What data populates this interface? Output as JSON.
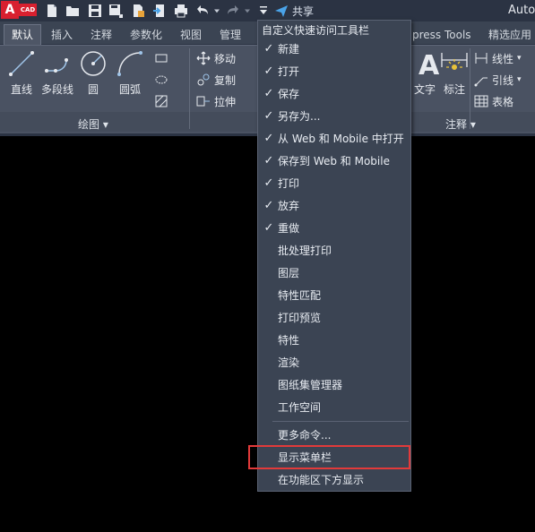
{
  "app": {
    "logo_a": "A",
    "logo_cad": "CAD",
    "title": "Autoc"
  },
  "qat": {
    "share_label": "共享",
    "icons": [
      "new-file-icon",
      "open-folder-icon",
      "save-icon",
      "save-as-icon",
      "publish-icon",
      "import-icon",
      "print-icon",
      "undo-icon",
      "redo-icon",
      "customize-dropdown-icon"
    ]
  },
  "tabs": [
    {
      "label": "默认",
      "active": true
    },
    {
      "label": "插入"
    },
    {
      "label": "注释"
    },
    {
      "label": "参数化"
    },
    {
      "label": "视图"
    },
    {
      "label": "管理"
    },
    {
      "label": "press Tools"
    },
    {
      "label": "精选应用"
    }
  ],
  "ribbon": {
    "draw_tools": [
      "直线",
      "多段线",
      "圆",
      "圆弧"
    ],
    "modify_tools": [
      "移动",
      "复制",
      "拉伸"
    ],
    "annotation_tools": [
      "文字",
      "标注"
    ],
    "annotation_small": [
      "线性",
      "引线",
      "表格"
    ],
    "draw_panel_title": "绘图 ▾",
    "annotation_panel_title": "注释 ▾"
  },
  "menu": {
    "header": "自定义快速访问工具栏",
    "items": [
      {
        "label": "新建",
        "checked": true
      },
      {
        "label": "打开",
        "checked": true
      },
      {
        "label": "保存",
        "checked": true
      },
      {
        "label": "另存为...",
        "checked": true
      },
      {
        "label": "从 Web 和 Mobile 中打开",
        "checked": true
      },
      {
        "label": "保存到 Web 和 Mobile",
        "checked": true
      },
      {
        "label": "打印",
        "checked": true
      },
      {
        "label": "放弃",
        "checked": true
      },
      {
        "label": "重做",
        "checked": true
      },
      {
        "label": "批处理打印",
        "checked": false
      },
      {
        "label": "图层",
        "checked": false
      },
      {
        "label": "特性匹配",
        "checked": false
      },
      {
        "label": "打印预览",
        "checked": false
      },
      {
        "label": "特性",
        "checked": false
      },
      {
        "label": "渲染",
        "checked": false
      },
      {
        "label": "图纸集管理器",
        "checked": false
      },
      {
        "label": "工作空间",
        "checked": false
      }
    ],
    "more_commands": "更多命令...",
    "show_menubar": "显示菜单栏",
    "show_below_ribbon": "在功能区下方显示",
    "check_mark": "✓"
  },
  "colors": {
    "highlight_box": "#e23a3a",
    "logo_red": "#d8202f",
    "menu_bg": "#3b4453"
  }
}
